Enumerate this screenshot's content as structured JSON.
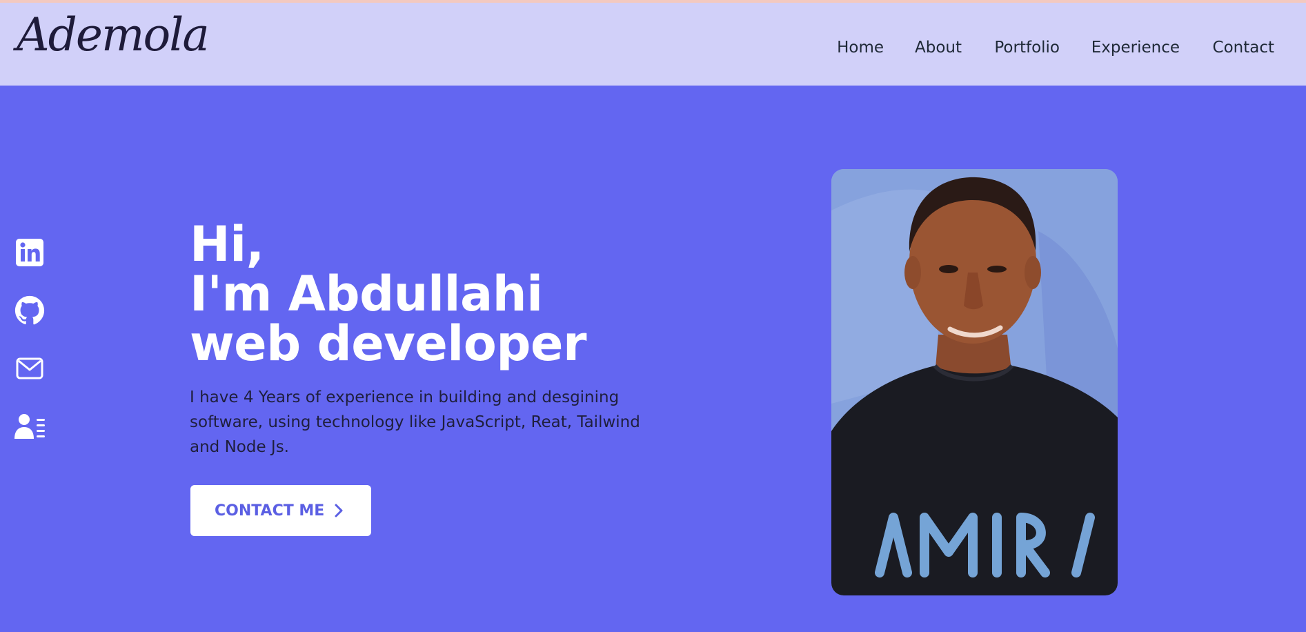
{
  "header": {
    "logo": "Ademola",
    "nav": [
      {
        "label": "Home"
      },
      {
        "label": "About"
      },
      {
        "label": "Portfolio"
      },
      {
        "label": "Experience"
      },
      {
        "label": "Contact"
      }
    ]
  },
  "social": [
    {
      "icon": "linkedin-icon"
    },
    {
      "icon": "github-icon"
    },
    {
      "icon": "mail-icon"
    },
    {
      "icon": "resume-icon"
    }
  ],
  "hero": {
    "line1": "Hi,",
    "line2": "I'm Abdullahi",
    "line3": "web developer",
    "description": "I have 4 Years of experience in building and desgining software, using technology like JavaScript, Reat, Tailwind and Node Js.",
    "cta_label": "CONTACT ME",
    "cta_icon": "chevron-right-icon",
    "shirt_text": "AMIRI"
  },
  "colors": {
    "background": "#6366f1",
    "header": "#d1d0f9",
    "accent": "#5b5fe3",
    "white": "#ffffff"
  }
}
